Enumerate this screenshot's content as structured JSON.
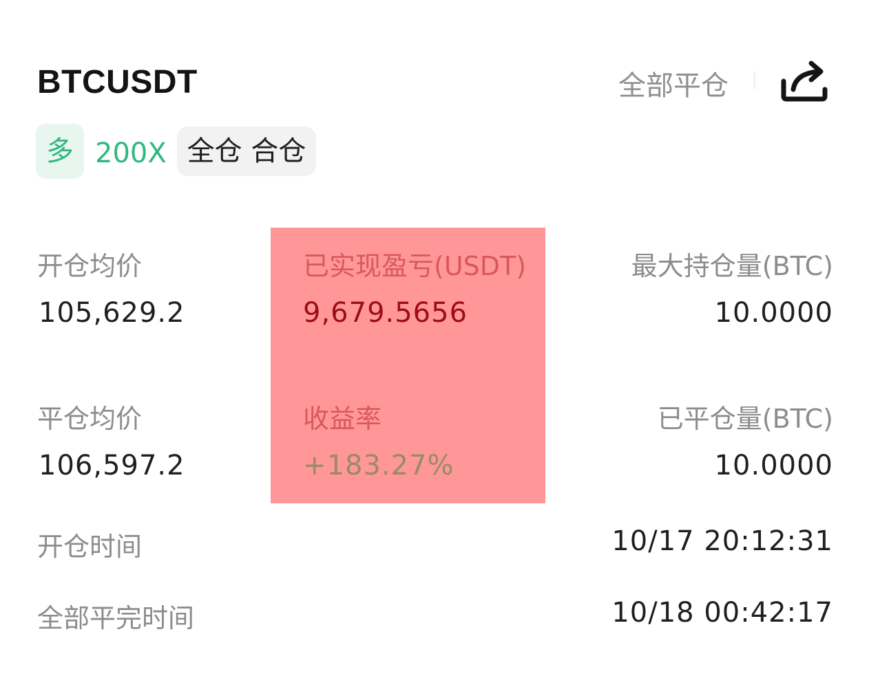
{
  "header": {
    "symbol": "BTCUSDT",
    "close_all_label": "全部平仓",
    "share_icon": "share-icon"
  },
  "tags": {
    "side": "多",
    "leverage": "200X",
    "margin_mode": "全仓 合仓"
  },
  "stats": {
    "open_avg_price_label": "开仓均价",
    "open_avg_price": "105,629.2",
    "realized_pnl_label": "已实现盈亏(USDT)",
    "realized_pnl": "9,679.5656",
    "max_position_label": "最大持仓量(BTC)",
    "max_position": "10.0000",
    "close_avg_price_label": "平仓均价",
    "close_avg_price": "106,597.2",
    "roi_label": "收益率",
    "roi": "+183.27%",
    "closed_qty_label": "已平仓量(BTC)",
    "closed_qty": "10.0000"
  },
  "times": {
    "open_time_label": "开仓时间",
    "open_time": "10/17 20:12:31",
    "close_time_label": "全部平完时间",
    "close_time": "10/18 00:42:17"
  },
  "colors": {
    "long_green": "#2fb782",
    "highlight": "#ff9799",
    "label_gray": "#8c8c8c"
  }
}
